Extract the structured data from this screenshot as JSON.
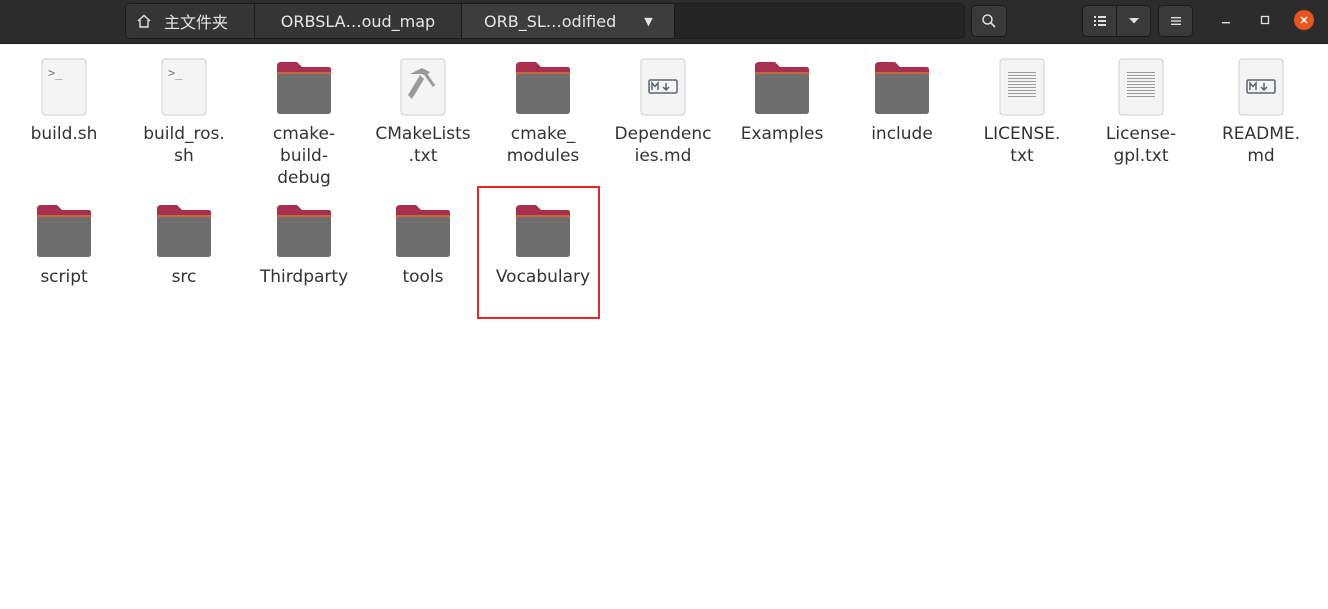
{
  "pathbar": {
    "home_label": "主文件夹",
    "crumb2": "ORBSLA…oud_map",
    "crumb3": "ORB_SL…odified"
  },
  "icons": {
    "home": "home-icon",
    "search": "search-icon",
    "list_view": "list-view-icon",
    "view_menu": "chevron-down-icon",
    "menu": "hamburger-icon",
    "minimize": "minimize-icon",
    "maximize": "maximize-icon",
    "close": "close-icon"
  },
  "colors": {
    "headerbar": "#2c2c2c",
    "folder_tab": "#a8304f",
    "folder_body": "#6e6e6e",
    "close_button": "#e95420",
    "selection_highlight": "#e8262a"
  },
  "files": [
    {
      "name": "build.sh",
      "type": "script"
    },
    {
      "name": "build_ros.\nsh",
      "type": "script"
    },
    {
      "name": "cmake-\nbuild-\ndebug",
      "type": "folder"
    },
    {
      "name": "CMakeLists\n.txt",
      "type": "cmake"
    },
    {
      "name": "cmake_\nmodules",
      "type": "folder"
    },
    {
      "name": "Dependenc\nies.md",
      "type": "markdown"
    },
    {
      "name": "Examples",
      "type": "folder"
    },
    {
      "name": "include",
      "type": "folder"
    },
    {
      "name": "LICENSE.\ntxt",
      "type": "text"
    },
    {
      "name": "License-\ngpl.txt",
      "type": "text"
    },
    {
      "name": "README.\nmd",
      "type": "markdown"
    },
    {
      "name": "script",
      "type": "folder"
    },
    {
      "name": "src",
      "type": "folder"
    },
    {
      "name": "Thirdparty",
      "type": "folder"
    },
    {
      "name": "tools",
      "type": "folder"
    },
    {
      "name": "Vocabulary",
      "type": "folder",
      "highlighted": true
    }
  ]
}
